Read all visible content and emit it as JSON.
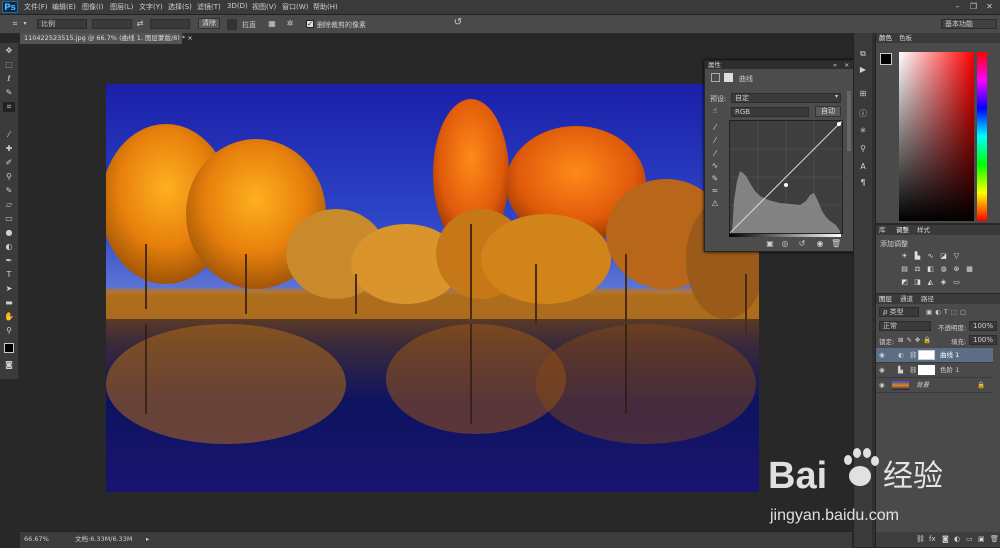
{
  "app": {
    "logo": "Ps"
  },
  "menu": [
    "文件(F)",
    "编辑(E)",
    "图像(I)",
    "图层(L)",
    "文字(Y)",
    "选择(S)",
    "滤镜(T)",
    "3D(D)",
    "视图(V)",
    "窗口(W)",
    "帮助(H)"
  ],
  "window_controls": {
    "minimize": "–",
    "restore": "❐",
    "close": "✕"
  },
  "options": {
    "ratio_label": "比例",
    "swap_symbol": "⇄",
    "clear_label": "清除",
    "straighten_label": "拉直",
    "delete_cropped_label": "删除裁剪的像素",
    "delete_cropped_checked": true,
    "workspace": "基本功能"
  },
  "document": {
    "tab_title": "110422523515.jpg @ 66.7% (曲线 1, 图层蒙版/8) *",
    "close_symbol": "×"
  },
  "status": {
    "zoom": "66.67%",
    "doc_info": "文档:6.33M/6.33M"
  },
  "properties": {
    "tab_label": "属性",
    "title": "曲线",
    "preset_label": "预设:",
    "preset_value": "自定",
    "channel_value": "RGB",
    "auto_label": "自动"
  },
  "color_panel": {
    "tab1": "颜色",
    "tab2": "色板"
  },
  "adjustments_panel": {
    "tab1": "库",
    "tab2": "调整",
    "tab3": "样式",
    "heading": "添加调整"
  },
  "layers_panel": {
    "tab1": "图层",
    "tab2": "通道",
    "tab3": "路径",
    "kind_filter": "ρ 类型",
    "blend_mode": "正常",
    "opacity_label": "不透明度:",
    "opacity_value": "100%",
    "lock_label": "锁定:",
    "fill_label": "填充:",
    "fill_value": "100%",
    "layers": [
      {
        "name": "曲线 1",
        "selected": true
      },
      {
        "name": "色阶 1",
        "selected": false
      },
      {
        "name": "背景",
        "selected": false
      }
    ]
  },
  "watermark": {
    "brand": "Bai",
    "brand_cn": "经验",
    "url": "jingyan.baidu.com"
  },
  "colors": {
    "accent_blue": "#4fb3ff",
    "selected_layer": "#5c6d86"
  }
}
